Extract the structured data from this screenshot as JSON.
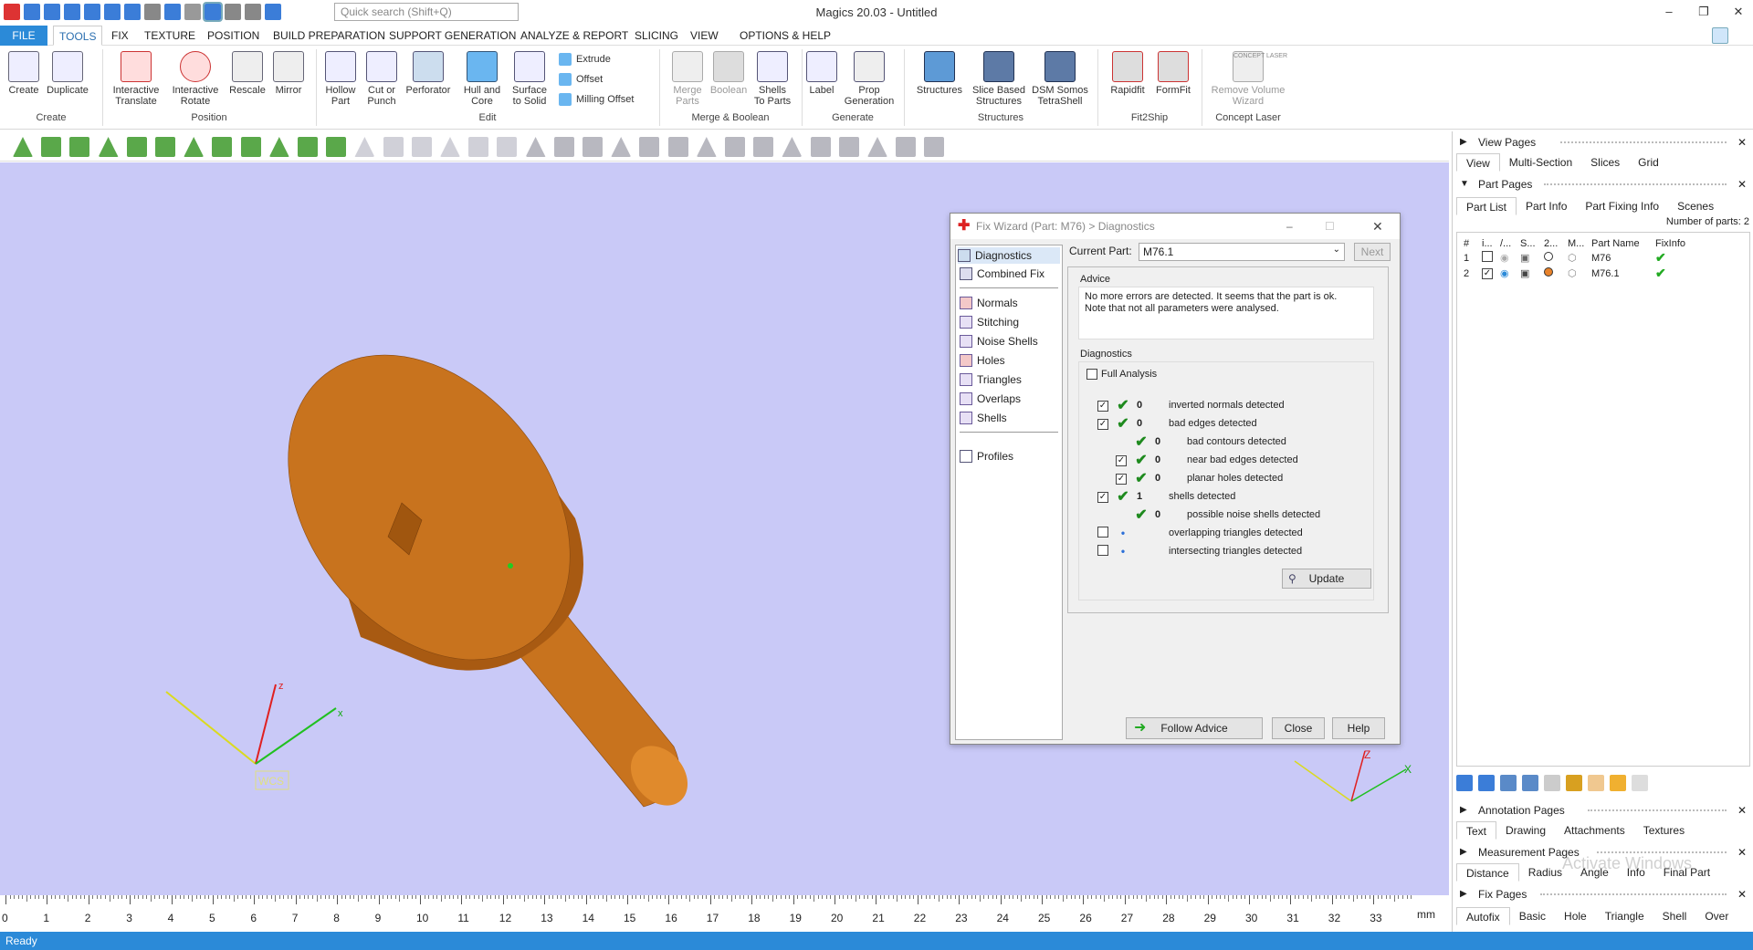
{
  "window": {
    "title": "Magics 20.03 - Untitled",
    "search_placeholder": "Quick search (Shift+Q)"
  },
  "menu": [
    "FILE",
    "TOOLS",
    "FIX",
    "TEXTURE",
    "POSITION",
    "BUILD PREPARATION",
    "SUPPORT GENERATION",
    "ANALYZE & REPORT",
    "SLICING",
    "VIEW",
    "OPTIONS & HELP"
  ],
  "ribbon": {
    "buttons": [
      {
        "label": "Create"
      },
      {
        "label": "Duplicate"
      },
      {
        "label": "Interactive\nTranslate"
      },
      {
        "label": "Interactive\nRotate"
      },
      {
        "label": "Rescale"
      },
      {
        "label": "Mirror"
      },
      {
        "label": "Hollow\nPart"
      },
      {
        "label": "Cut or\nPunch"
      },
      {
        "label": "Perforator"
      },
      {
        "label": "Hull and\nCore"
      },
      {
        "label": "Surface\nto Solid"
      },
      {
        "label": "Merge\nParts"
      },
      {
        "label": "Boolean"
      },
      {
        "label": "Shells\nTo Parts"
      },
      {
        "label": "Label"
      },
      {
        "label": "Prop\nGeneration"
      },
      {
        "label": "Structures"
      },
      {
        "label": "Slice Based\nStructures"
      },
      {
        "label": "DSM Somos\nTetraShell"
      },
      {
        "label": "Rapidfit"
      },
      {
        "label": "FormFit"
      },
      {
        "label": "Remove Volume\nWizard"
      }
    ],
    "small": [
      "Extrude",
      "Offset",
      "Milling Offset"
    ],
    "groups": [
      "Create",
      "Position",
      "Edit",
      "Merge & Boolean",
      "Generate",
      "Structures",
      "Fit2Ship",
      "Concept Laser"
    ],
    "logo_text": "CONCEPT LASER"
  },
  "viewport": {
    "axis_labels": {
      "z": "z",
      "x": "x",
      "wcs": "WCS",
      "Z": "Z",
      "X": "X"
    },
    "part_color": "#c8731e",
    "background": "#c9c9f7",
    "ruler_ticks": [
      "0",
      "1",
      "2",
      "3",
      "4",
      "5",
      "6",
      "7",
      "8",
      "9",
      "10",
      "11",
      "12",
      "13",
      "14",
      "15",
      "16",
      "17",
      "18",
      "19",
      "20",
      "21",
      "22",
      "23",
      "24",
      "25",
      "26",
      "27",
      "28",
      "29",
      "30",
      "31",
      "32",
      "33"
    ],
    "ruler_unit": "mm"
  },
  "fix_wizard": {
    "title": "Fix Wizard (Part: M76) > Diagnostics",
    "nav_top": [
      "Diagnostics",
      "Combined Fix"
    ],
    "nav_items": [
      "Normals",
      "Stitching",
      "Noise Shells",
      "Holes",
      "Triangles",
      "Overlaps",
      "Shells"
    ],
    "nav_bottom": [
      "Profiles"
    ],
    "current_part_label": "Current Part:",
    "current_part_value": "M76.1",
    "next_label": "Next",
    "advice_title": "Advice",
    "advice_text": "No more errors are detected. It seems that the part is ok.\nNote that not all parameters were analysed.",
    "diagnostics_title": "Diagnostics",
    "full_analysis": "Full Analysis",
    "rows": [
      {
        "checked": true,
        "status": "ok",
        "count": "0",
        "label": "inverted normals detected",
        "indent": 0
      },
      {
        "checked": true,
        "status": "ok",
        "count": "0",
        "label": "bad edges detected",
        "indent": 0
      },
      {
        "checked": null,
        "status": "ok",
        "count": "0",
        "label": "bad contours detected",
        "indent": 1
      },
      {
        "checked": true,
        "status": "ok",
        "count": "0",
        "label": "near bad edges detected",
        "indent": 1
      },
      {
        "checked": true,
        "status": "ok",
        "count": "0",
        "label": "planar holes detected",
        "indent": 1
      },
      {
        "checked": true,
        "status": "ok",
        "count": "1",
        "label": "shells detected",
        "indent": 0
      },
      {
        "checked": null,
        "status": "ok",
        "count": "0",
        "label": "possible noise shells detected",
        "indent": 1
      },
      {
        "checked": false,
        "status": "dot",
        "count": "",
        "label": "overlapping triangles detected",
        "indent": 0
      },
      {
        "checked": false,
        "status": "dot",
        "count": "",
        "label": "intersecting triangles detected",
        "indent": 0
      }
    ],
    "update_label": "Update",
    "follow_advice_label": "Follow Advice",
    "close_label": "Close",
    "help_label": "Help"
  },
  "right_panel": {
    "view_pages": "View Pages",
    "view_tabs": [
      "View",
      "Multi-Section",
      "Slices",
      "Grid"
    ],
    "part_pages": "Part Pages",
    "part_tabs": [
      "Part List",
      "Part Info",
      "Part Fixing Info",
      "Scenes"
    ],
    "parts_count": "Number of parts: 2",
    "columns": [
      "#",
      "i...",
      "/...",
      "S...",
      "2...",
      "M...",
      "Part Name",
      "FixInfo"
    ],
    "parts": [
      {
        "num": "1",
        "checked": false,
        "name": "M76",
        "color": "#ffffff"
      },
      {
        "num": "2",
        "checked": true,
        "name": "M76.1",
        "color": "#e8822a"
      }
    ],
    "annotation_pages": "Annotation Pages",
    "annotation_tabs": [
      "Text",
      "Drawing",
      "Attachments",
      "Textures"
    ],
    "measurement_pages": "Measurement Pages",
    "measurement_tabs": [
      "Distance",
      "Radius",
      "Angle",
      "Info",
      "Final Part"
    ],
    "fix_pages": "Fix Pages",
    "fix_tabs": [
      "Autofix",
      "Basic",
      "Hole",
      "Triangle",
      "Shell",
      "Over"
    ],
    "watermark": "Activate Windows"
  },
  "status": {
    "text": "Ready"
  }
}
